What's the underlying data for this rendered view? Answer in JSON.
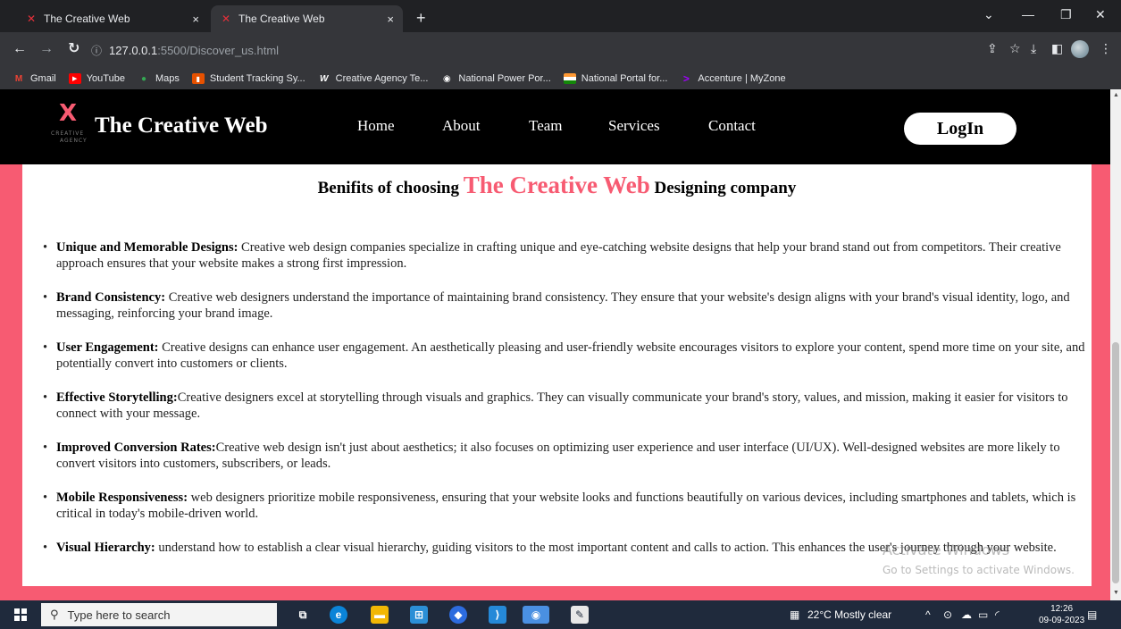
{
  "browser": {
    "tabs": [
      {
        "title": "The Creative Web",
        "close": "×"
      },
      {
        "title": "The Creative Web",
        "close": "×"
      }
    ],
    "new_tab": "+",
    "url_host": "127.0.0.1",
    "url_path": ":5500/Discover_us.html",
    "bookmarks": [
      "Gmail",
      "YouTube",
      "Maps",
      "Student Tracking Sy...",
      "Creative Agency Te...",
      "National Power Por...",
      "National Portal for...",
      "Accenture | MyZone"
    ]
  },
  "site": {
    "brand": "The Creative Web",
    "logo_sub1": "CREATIVE",
    "logo_sub2": "AGENCY",
    "nav": [
      "Home",
      "About",
      "Team",
      "Services",
      "Contact"
    ],
    "login": "LogIn",
    "heading_pre": "Benifits of choosing ",
    "heading_highlight": "The Creative Web",
    "heading_post": " Designing company",
    "benefits": [
      {
        "title": "Unique and Memorable Designs:",
        "text": " Creative web design companies specialize in crafting unique and eye-catching website designs that help your brand stand out from competitors. Their creative approach ensures that your website makes a strong first impression."
      },
      {
        "title": "Brand Consistency:",
        "text": " Creative web designers understand the importance of maintaining brand consistency. They ensure that your website's design aligns with your brand's visual identity, logo, and messaging, reinforcing your brand image."
      },
      {
        "title": "User Engagement:",
        "text": " Creative designs can enhance user engagement. An aesthetically pleasing and user-friendly website encourages visitors to explore your content, spend more time on your site, and potentially convert into customers or clients."
      },
      {
        "title": "Effective Storytelling:",
        "text": "Creative designers excel at storytelling through visuals and graphics. They can visually communicate your brand's story, values, and mission, making it easier for visitors to connect with your message."
      },
      {
        "title": "Improved Conversion Rates:",
        "text": "Creative web design isn't just about aesthetics; it also focuses on optimizing user experience and user interface (UI/UX). Well-designed websites are more likely to convert visitors into customers, subscribers, or leads."
      },
      {
        "title": "Mobile Responsiveness:",
        "text": " web designers prioritize mobile responsiveness, ensuring that your website looks and functions beautifully on various devices, including smartphones and tablets, which is critical in today's mobile-driven world."
      },
      {
        "title": "Visual Hierarchy:",
        "text": " understand how to establish a clear visual hierarchy, guiding visitors to the most important content and calls to action. This enhances the user's journey through your website."
      }
    ]
  },
  "watermark": {
    "line1": "Activate Windows",
    "line2": "Go to Settings to activate Windows."
  },
  "taskbar": {
    "search_placeholder": "Type here to search",
    "weather": "22°C  Mostly clear",
    "time": "12:26",
    "date": "09-09-2023"
  },
  "colors": {
    "accent": "#f75b72",
    "nav_bg": "#000000"
  }
}
